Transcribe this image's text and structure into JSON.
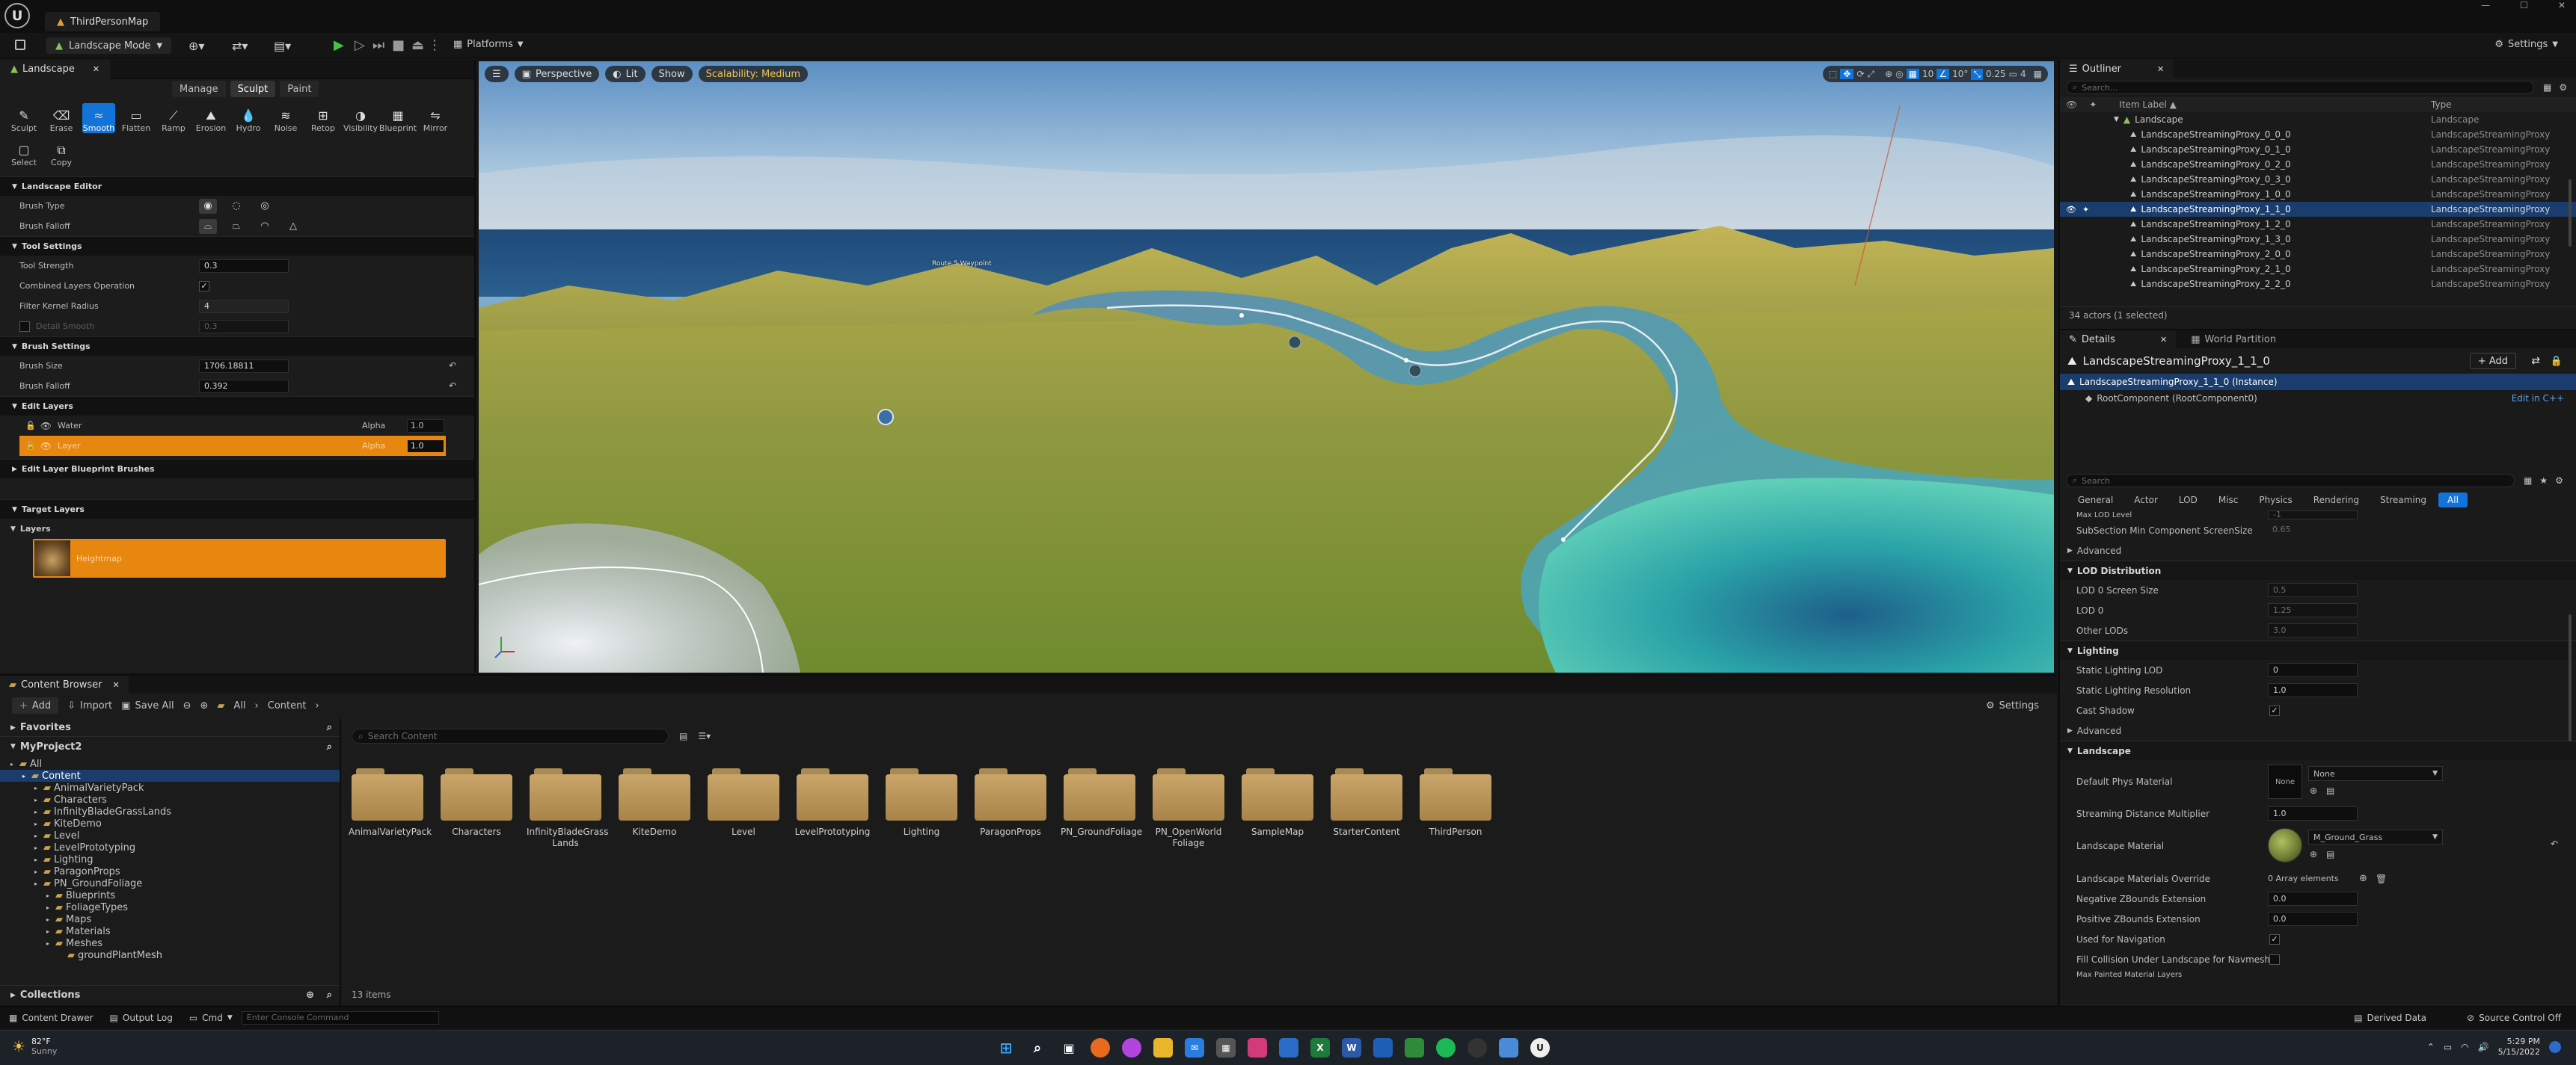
{
  "window": {
    "project_tab": "ThirdPersonMap"
  },
  "toolbar": {
    "mode_label": "Landscape Mode",
    "platforms_label": "Platforms",
    "settings_label": "Settings"
  },
  "landscape_panel": {
    "tab_label": "Landscape",
    "modes": [
      "Manage",
      "Sculpt",
      "Paint"
    ],
    "active_mode": "Sculpt",
    "tools": [
      "Sculpt",
      "Erase",
      "Smooth",
      "Flatten",
      "Ramp",
      "Erosion",
      "Hydro",
      "Noise",
      "Retop",
      "Visibility",
      "Blueprint",
      "Mirror",
      "Select",
      "Copy"
    ],
    "active_tool": "Smooth",
    "landscape_editor": "Landscape Editor",
    "brush_type": "Brush Type",
    "brush_falloff": "Brush Falloff",
    "tool_settings": "Tool Settings",
    "tool_strength_label": "Tool Strength",
    "tool_strength": "0.3",
    "combined_layers_label": "Combined Layers Operation",
    "filter_kernel_label": "Filter Kernel Radius",
    "filter_kernel": "4",
    "detail_smooth_label": "Detail Smooth",
    "detail_smooth": "0.3",
    "brush_settings": "Brush Settings",
    "brush_size_label": "Brush Size",
    "brush_size": "1706.18811",
    "brush_falloff_label": "Brush Falloff",
    "brush_falloff_value": "0.392",
    "edit_layers": "Edit Layers",
    "layers": [
      {
        "name": "Water",
        "alpha_label": "Alpha",
        "alpha": "1.0"
      },
      {
        "name": "Layer",
        "alpha_label": "Alpha",
        "alpha": "1.0"
      }
    ],
    "edit_layer_bp_brushes": "Edit Layer Blueprint Brushes",
    "target_layers": "Target Layers",
    "layers_section": "Layers",
    "target_layer_name": "Heightmap"
  },
  "viewport": {
    "perspective": "Perspective",
    "lit": "Lit",
    "show": "Show",
    "scalability": "Scalability: Medium",
    "label_in_scene": "Route 5 Waypoint",
    "toolbar_values": {
      "grid": "10",
      "angle": "10°",
      "scale": "0.25",
      "camera_speed": "4"
    }
  },
  "outliner": {
    "tab_label": "Outliner",
    "search_placeholder": "Search...",
    "col_label": "Item Label ▲",
    "col_type": "Type",
    "folder": "Landscape",
    "folder_type": "Landscape",
    "items": [
      {
        "label": "LandscapeStreamingProxy_0_0_0",
        "type": "LandscapeStreamingProxy"
      },
      {
        "label": "LandscapeStreamingProxy_0_1_0",
        "type": "LandscapeStreamingProxy"
      },
      {
        "label": "LandscapeStreamingProxy_0_2_0",
        "type": "LandscapeStreamingProxy"
      },
      {
        "label": "LandscapeStreamingProxy_0_3_0",
        "type": "LandscapeStreamingProxy"
      },
      {
        "label": "LandscapeStreamingProxy_1_0_0",
        "type": "LandscapeStreamingProxy"
      },
      {
        "label": "LandscapeStreamingProxy_1_1_0",
        "type": "LandscapeStreamingProxy",
        "selected": true
      },
      {
        "label": "LandscapeStreamingProxy_1_2_0",
        "type": "LandscapeStreamingProxy"
      },
      {
        "label": "LandscapeStreamingProxy_1_3_0",
        "type": "LandscapeStreamingProxy"
      },
      {
        "label": "LandscapeStreamingProxy_2_0_0",
        "type": "LandscapeStreamingProxy"
      },
      {
        "label": "LandscapeStreamingProxy_2_1_0",
        "type": "LandscapeStreamingProxy"
      },
      {
        "label": "LandscapeStreamingProxy_2_2_0",
        "type": "LandscapeStreamingProxy"
      }
    ],
    "footer": "34 actors (1 selected)"
  },
  "details": {
    "tab_label": "Details",
    "tab2_label": "World Partition",
    "object_name": "LandscapeStreamingProxy_1_1_0",
    "add_label": "+ Add",
    "instance": "LandscapeStreamingProxy_1_1_0 (Instance)",
    "root_component": "RootComponent (RootComponent0)",
    "edit_cpp": "Edit in C++",
    "search_placeholder": "Search",
    "filters": [
      "General",
      "Actor",
      "LOD",
      "Misc",
      "Physics",
      "Rendering",
      "Streaming",
      "All"
    ],
    "active_filter": "All",
    "max_lod_label": "Max LOD Level",
    "max_lod": "-1",
    "subsection_label": "SubSection Min Component ScreenSize",
    "subsection": "0.65",
    "advanced": "Advanced",
    "lod_distribution": "LOD Distribution",
    "lod0_screen_label": "LOD 0 Screen Size",
    "lod0_screen": "0.5",
    "lod0_label": "LOD 0",
    "lod0": "1.25",
    "other_lods_label": "Other LODs",
    "other_lods": "3.0",
    "lighting": "Lighting",
    "static_lod_label": "Static Lighting LOD",
    "static_lod": "0",
    "static_res_label": "Static Lighting Resolution",
    "static_res": "1.0",
    "cast_shadow_label": "Cast Shadow",
    "landscape_section": "Landscape",
    "phys_mat_label": "Default Phys Material",
    "phys_mat": "None",
    "streaming_dist_label": "Streaming Distance Multiplier",
    "streaming_dist": "1.0",
    "landscape_mat_label": "Landscape Material",
    "landscape_mat": "M_Ground_Grass",
    "mat_override_label": "Landscape Materials Override",
    "mat_override": "0 Array elements",
    "neg_z_label": "Negative ZBounds Extension",
    "neg_z": "0.0",
    "pos_z_label": "Positive ZBounds Extension",
    "pos_z": "0.0",
    "nav_label": "Used for Navigation",
    "fill_collision_label": "Fill Collision Under Landscape for Navmesh",
    "max_painted_label": "Max Painted Material Layers"
  },
  "content_browser": {
    "tab_label": "Content Browser",
    "add": "Add",
    "import": "Import",
    "save_all": "Save All",
    "crumb_all": "All",
    "crumb_content": "Content",
    "settings": "Settings",
    "favorites": "Favorites",
    "project": "MyProject2",
    "search_placeholder": "Search Content",
    "tree": [
      {
        "label": "All",
        "depth": 0
      },
      {
        "label": "Content",
        "depth": 1,
        "selected": true
      },
      {
        "label": "AnimalVarietyPack",
        "depth": 2
      },
      {
        "label": "Characters",
        "depth": 2
      },
      {
        "label": "InfinityBladeGrassLands",
        "depth": 2
      },
      {
        "label": "KiteDemo",
        "depth": 2
      },
      {
        "label": "Level",
        "depth": 2
      },
      {
        "label": "LevelPrototyping",
        "depth": 2
      },
      {
        "label": "Lighting",
        "depth": 2
      },
      {
        "label": "ParagonProps",
        "depth": 2
      },
      {
        "label": "PN_GroundFoliage",
        "depth": 2
      },
      {
        "label": "Blueprints",
        "depth": 3
      },
      {
        "label": "FoliageTypes",
        "depth": 3
      },
      {
        "label": "Maps",
        "depth": 3
      },
      {
        "label": "Materials",
        "depth": 3
      },
      {
        "label": "Meshes",
        "depth": 3
      },
      {
        "label": "groundPlantMesh",
        "depth": 4
      }
    ],
    "folders": [
      "AnimalVarietyPack",
      "Characters",
      "InfinityBladeGrass Lands",
      "KiteDemo",
      "Level",
      "LevelPrototyping",
      "Lighting",
      "ParagonProps",
      "PN_GroundFoliage",
      "PN_OpenWorld Foliage",
      "SampleMap",
      "StarterContent",
      "ThirdPerson"
    ],
    "item_count": "13 items",
    "collections": "Collections"
  },
  "statusbar": {
    "content_drawer": "Content Drawer",
    "output_log": "Output Log",
    "cmd": "Cmd",
    "console_placeholder": "Enter Console Command",
    "derived_data": "Derived Data",
    "source_control": "Source Control Off"
  },
  "taskbar": {
    "weather_temp": "82°F",
    "weather_desc": "Sunny",
    "time": "5:29 PM",
    "date": "5/15/2022"
  },
  "colors": {
    "accent": "#1273d8",
    "layer_orange": "#e8870f",
    "panel": "#1c1c1c"
  }
}
